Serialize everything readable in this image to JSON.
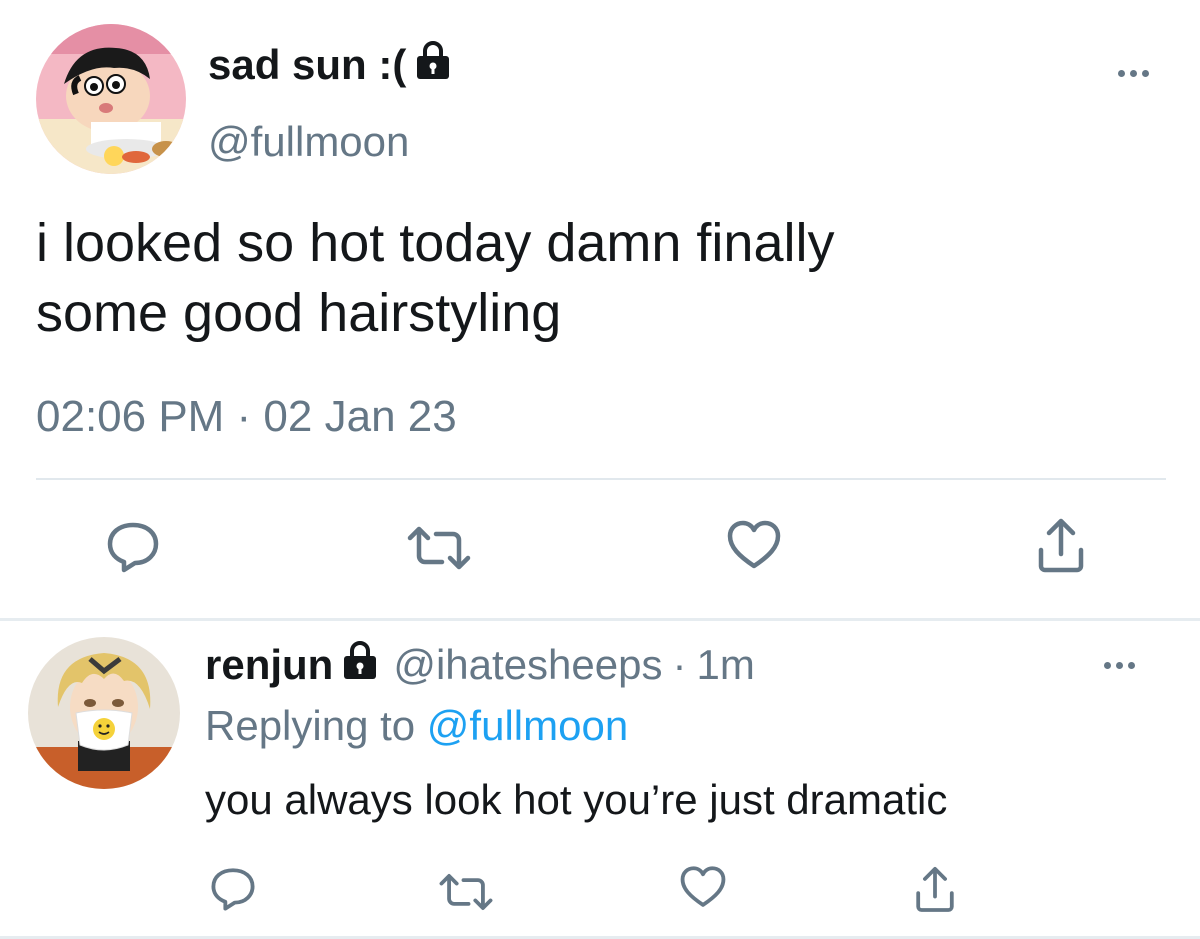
{
  "main_tweet": {
    "display_name": "sad sun :(",
    "handle": "@fullmoon",
    "text_line1": "i looked so hot today damn finally",
    "text_line2": "some good hairstyling",
    "timestamp": "02:06 PM · 02 Jan 23",
    "locked": true
  },
  "reply_tweet": {
    "display_name": "renjun",
    "handle": "@ihatesheeps",
    "separator": "·",
    "time": "1m",
    "replying_prefix": "Replying to",
    "replying_to": "@fullmoon",
    "text": "you always look hot you’re just dramatic",
    "locked": true
  },
  "icons": [
    "lock-icon",
    "more-icon",
    "reply-icon",
    "retweet-icon",
    "like-icon",
    "share-icon"
  ],
  "colors": {
    "text": "#14171a",
    "secondary": "#657786",
    "link": "#1da1f2",
    "divider": "#e1e8ed"
  }
}
